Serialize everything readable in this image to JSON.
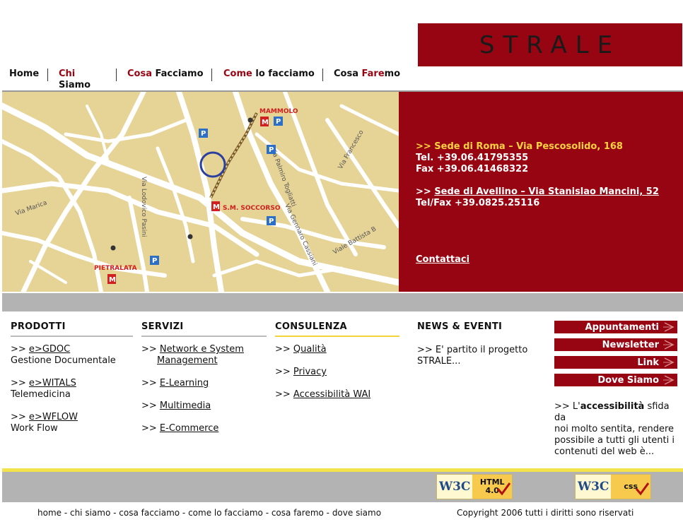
{
  "brand": {
    "logo_text": "STRALE",
    "color": "#980512"
  },
  "nav": {
    "home": "Home",
    "chi_a": "Chi",
    "chi_b": "Siamo",
    "cosa_a": "Cosa",
    "cosa_b": " Facciamo",
    "come_a": "Come",
    "come_b": " lo facciamo",
    "faremo_a": "Cosa ",
    "faremo_b": "Fare",
    "faremo_c": "mo"
  },
  "map": {
    "labels": [
      "MAMMOLO",
      "S.M. SOCCORSO",
      "PIETRALATA",
      "Via Marica",
      "Via Palmiro Togliatti",
      "Viale Battista B",
      "Via Lodovico Pasini",
      "Via Gennaro Cassiani",
      "Via Francesco"
    ]
  },
  "contact": {
    "roma": ">> Sede di Roma – Via Pescosolido, 168",
    "roma_tel": "Tel. +39.06.41795355",
    "roma_fax": "Fax +39.06.41468322",
    "av_prefix": ">> ",
    "avellino": "Sede di Avellino – Via Stanislao Mancini, 52",
    "av_telfax": "Tel/Fax +39.0825.25116",
    "contattaci": "Contattaci"
  },
  "prodotti": {
    "title": "PRODOTTI",
    "items": [
      {
        "prefix": ">> ",
        "link": "e>GDOC",
        "desc": "Gestione Documentale"
      },
      {
        "prefix": ">> ",
        "link": "e>WITALS",
        "desc": "Telemedicina"
      },
      {
        "prefix": ">> ",
        "link": "e>WFLOW",
        "desc": "Work Flow"
      }
    ]
  },
  "servizi": {
    "title": "SERVIZI",
    "items": [
      {
        "prefix": ">> ",
        "link_a": "Network e System",
        "link_b": "Management"
      },
      {
        "prefix": ">> ",
        "link_a": "E-Learning"
      },
      {
        "prefix": ">> ",
        "link_a": "Multimedia"
      },
      {
        "prefix": ">> ",
        "link_a": "E-Commerce"
      }
    ]
  },
  "consulenza": {
    "title": "CONSULENZA",
    "items": [
      {
        "prefix": ">> ",
        "link": "Qualità"
      },
      {
        "prefix": ">> ",
        "link": "Privacy"
      },
      {
        "prefix": ">> ",
        "link": "Accessibilità WAI"
      }
    ]
  },
  "news": {
    "title": "NEWS & EVENTI",
    "line1": ">> E' partito il progetto",
    "line2": "STRALE..."
  },
  "side_buttons": [
    "Appuntamenti",
    "Newsletter",
    "Link",
    "Dove Siamo"
  ],
  "accessibility": {
    "prefix": ">> L'",
    "bold": "accessibilità",
    "rest1": " sfida da",
    "line2": "noi molto sentita, rendere",
    "line3": "possibile a tutti gli utenti i",
    "line4": "contenuti del web è..."
  },
  "badges": {
    "html_logo": "W3C",
    "html_a": "HTML",
    "html_b": "4.0",
    "css_logo": "W3C",
    "css_a": "css"
  },
  "footer": {
    "links": "home - chi siamo - cosa facciamo - come lo facciamo - cosa faremo - dove siamo",
    "copyright": "Copyright 2006 tutti i diritti sono riservati"
  }
}
